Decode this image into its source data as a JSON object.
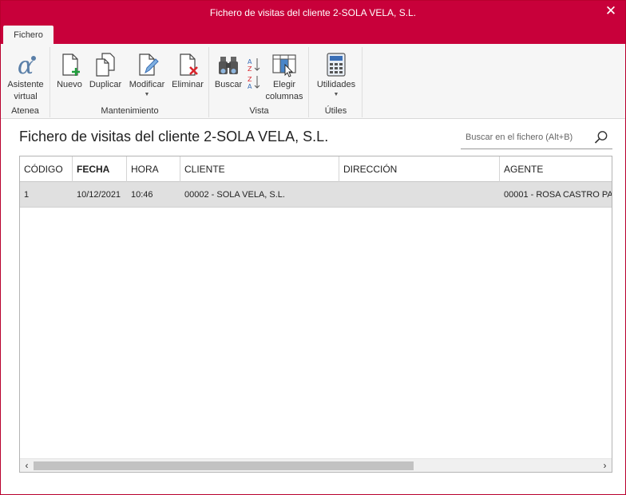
{
  "window": {
    "title": "Fichero de visitas del cliente 2-SOLA VELA, S.L.",
    "close_glyph": "✕"
  },
  "tabs": [
    {
      "label": "Fichero",
      "active": true
    }
  ],
  "ribbon": {
    "groups": [
      {
        "label": "Atenea",
        "buttons": [
          {
            "label_line1": "Asistente",
            "label_line2": "virtual",
            "icon": "alpha-icon"
          }
        ]
      },
      {
        "label": "Mantenimiento",
        "buttons": [
          {
            "label": "Nuevo",
            "icon": "new-document-icon"
          },
          {
            "label": "Duplicar",
            "icon": "duplicate-icon"
          },
          {
            "label": "Modificar",
            "icon": "edit-document-icon",
            "dropdown": true
          },
          {
            "label": "Eliminar",
            "icon": "delete-document-icon"
          }
        ]
      },
      {
        "label": "Vista",
        "buttons": [
          {
            "label": "Buscar",
            "icon": "binoculars-icon"
          },
          {
            "label": "",
            "icon": "sort-az-icon"
          },
          {
            "label_line1": "Elegir",
            "label_line2": "columnas",
            "icon": "choose-columns-icon"
          }
        ]
      },
      {
        "label": "Útiles",
        "buttons": [
          {
            "label": "Utilidades",
            "icon": "calculator-icon",
            "dropdown": true
          }
        ]
      }
    ]
  },
  "main": {
    "title": "Fichero de visitas del cliente 2-SOLA VELA, S.L.",
    "search_placeholder": "Buscar en el fichero (Alt+B)"
  },
  "table": {
    "columns": [
      "CÓDIGO",
      "FECHA",
      "HORA",
      "CLIENTE",
      "DIRECCIÓN",
      "AGENTE"
    ],
    "sorted_column": "FECHA",
    "rows": [
      {
        "codigo": "1",
        "fecha": "10/12/2021",
        "hora": "10:46",
        "cliente": "00002 - SOLA VELA, S.L.",
        "direccion": "",
        "agente": "00001 - ROSA CASTRO PA",
        "selected": true
      }
    ]
  },
  "scrollbar": {
    "left_arrow": "‹",
    "right_arrow": "›"
  },
  "colors": {
    "accent": "#c8003a",
    "ribbon_bg": "#f6f6f6",
    "selected_row": "#e0e0e0",
    "icon_blue": "#3b6fb6",
    "icon_green": "#1e9e3b",
    "icon_red": "#d9252c"
  }
}
